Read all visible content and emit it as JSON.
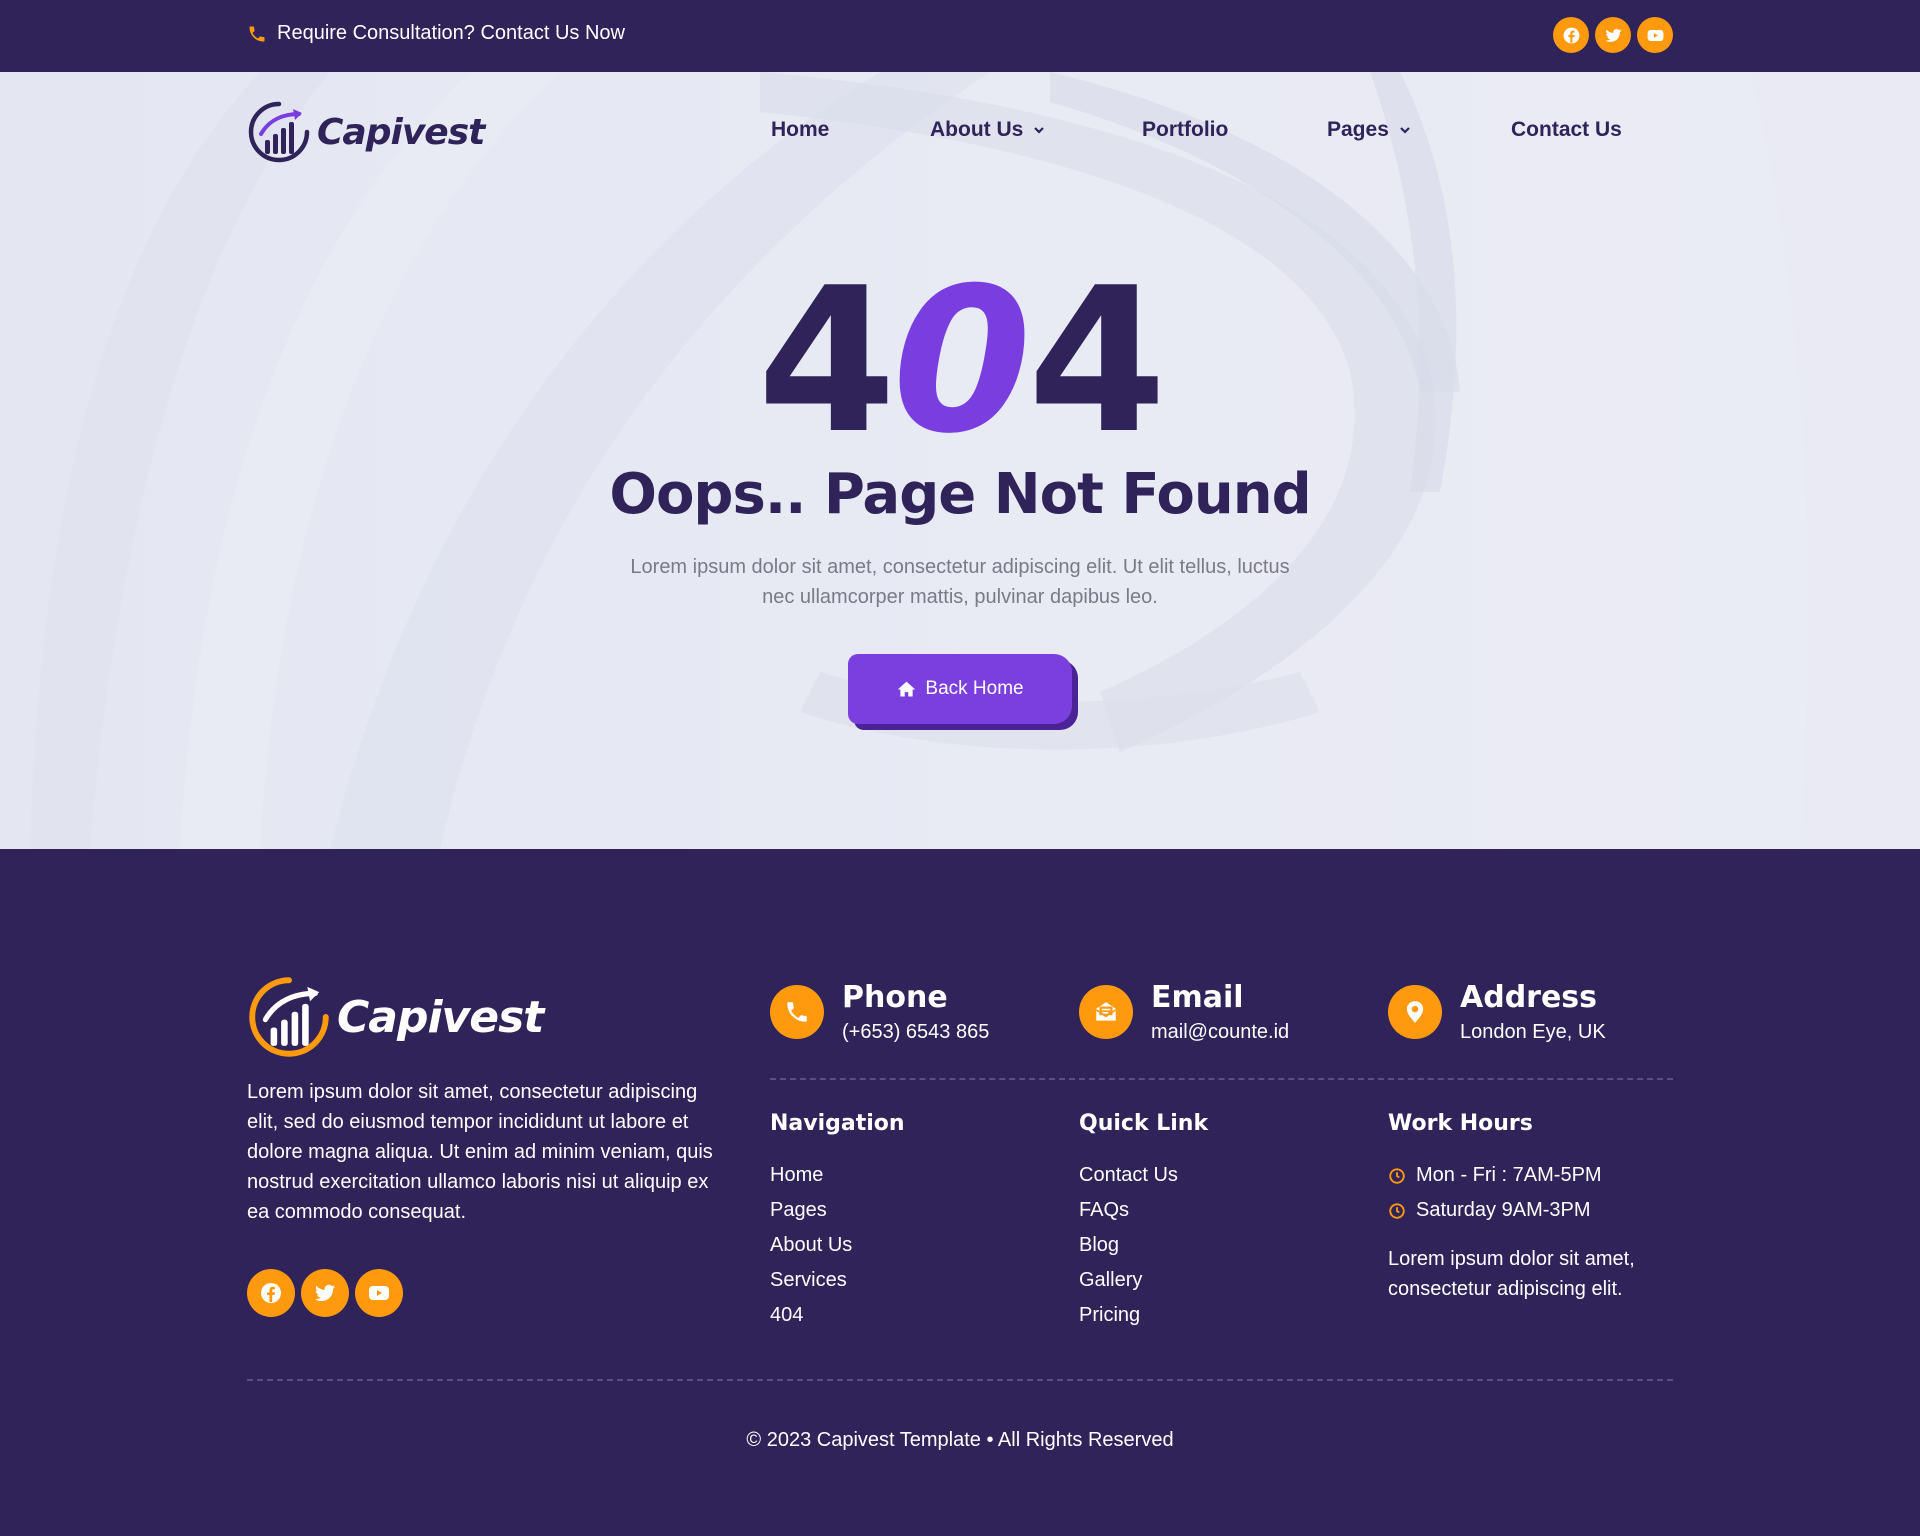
{
  "topbar": {
    "contact_text": "Require Consultation? Contact Us Now",
    "socials": [
      "facebook-icon",
      "twitter-icon",
      "youtube-icon"
    ]
  },
  "brand": {
    "name": "Capivest"
  },
  "nav": {
    "items": [
      {
        "label": "Home",
        "dropdown": false
      },
      {
        "label": "About Us",
        "dropdown": true
      },
      {
        "label": "Portfolio",
        "dropdown": false
      },
      {
        "label": "Pages",
        "dropdown": true
      },
      {
        "label": "Contact Us",
        "dropdown": false
      }
    ]
  },
  "error": {
    "code_left": "4",
    "code_mid": "0",
    "code_right": "4",
    "title": "Oops.. Page Not Found",
    "description": "Lorem ipsum dolor sit amet, consectetur adipiscing elit. Ut elit tellus, luctus nec ullamcorper mattis, pulvinar dapibus leo.",
    "button_label": "Back Home"
  },
  "footer": {
    "about": "Lorem ipsum dolor sit amet, consectetur adipiscing elit, sed do eiusmod tempor incididunt ut labore et dolore magna aliqua. Ut enim ad minim veniam, quis nostrud exercitation ullamco laboris nisi ut aliquip ex ea commodo consequat.",
    "contacts": [
      {
        "title": "Phone",
        "value": "(+653) 6543 865",
        "icon": "phone-icon"
      },
      {
        "title": "Email",
        "value": "mail@counte.id",
        "icon": "mail-icon"
      },
      {
        "title": "Address",
        "value": "London Eye, UK",
        "icon": "map-pin-icon"
      }
    ],
    "navigation": {
      "heading": "Navigation",
      "links": [
        "Home",
        "Pages",
        "About Us",
        "Services",
        "404"
      ]
    },
    "quick_link": {
      "heading": "Quick Link",
      "links": [
        "Contact Us",
        "FAQs",
        "Blog",
        "Gallery",
        "Pricing"
      ]
    },
    "work_hours": {
      "heading": "Work Hours",
      "hours": [
        "Mon - Fri : 7AM-5PM",
        "Saturday 9AM-3PM"
      ],
      "note": "Lorem ipsum dolor sit amet, consectetur adipiscing elit."
    },
    "copyright": "© 2023 Capivest Template • All Rights Reserved"
  },
  "colors": {
    "primary_dark": "#2f2359",
    "accent_purple": "#7b3fe0",
    "accent_orange": "#ff9a0e",
    "hero_bg": "#e6e9f3"
  }
}
